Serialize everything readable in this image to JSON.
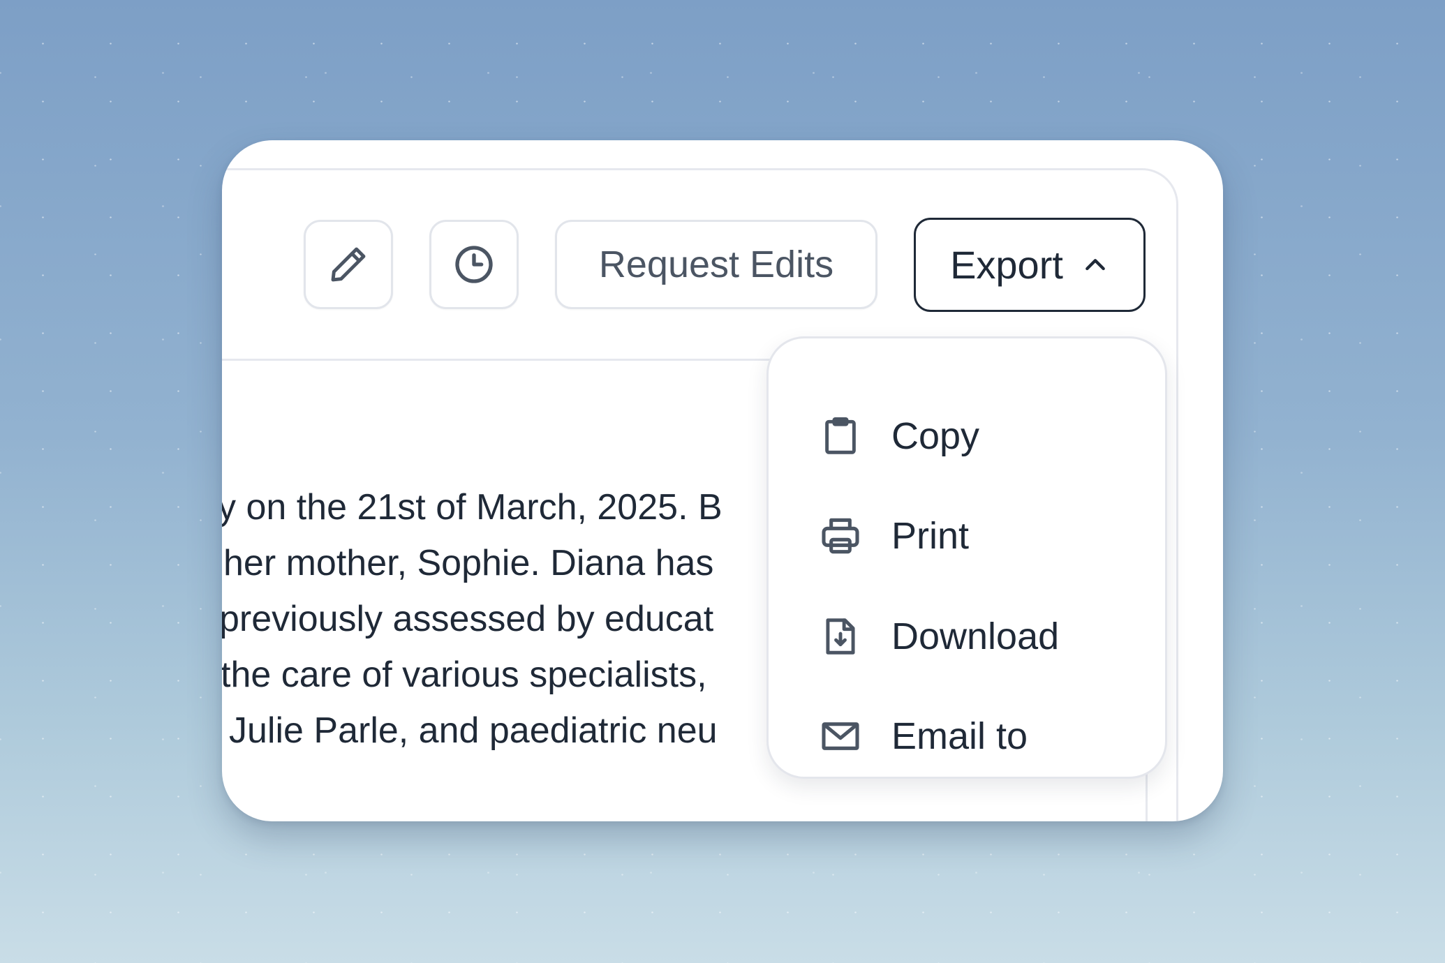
{
  "toolbar": {
    "edit_icon": "pencil-icon",
    "history_icon": "clock-icon",
    "request_edits_label": "Request Edits",
    "export_label": "Export",
    "export_chevron_icon": "chevron-up-icon"
  },
  "document": {
    "lines": [
      "y on the 21st of March, 2025. B",
      "her mother, Sophie. Diana has",
      "previously assessed by educat",
      "the care of various specialists,",
      "Julie Parle, and paediatric neu"
    ]
  },
  "export_menu": {
    "items": [
      {
        "label": "Copy",
        "icon": "clipboard-icon"
      },
      {
        "label": "Print",
        "icon": "printer-icon"
      },
      {
        "label": "Download",
        "icon": "download-file-icon"
      },
      {
        "label": "Email to",
        "icon": "mail-icon"
      }
    ]
  },
  "colors": {
    "text_primary": "#1f2937",
    "text_secondary": "#4b5563",
    "border": "#e2e5eb",
    "background_top": "#7d9fc6",
    "background_bottom": "#c9dde7"
  }
}
